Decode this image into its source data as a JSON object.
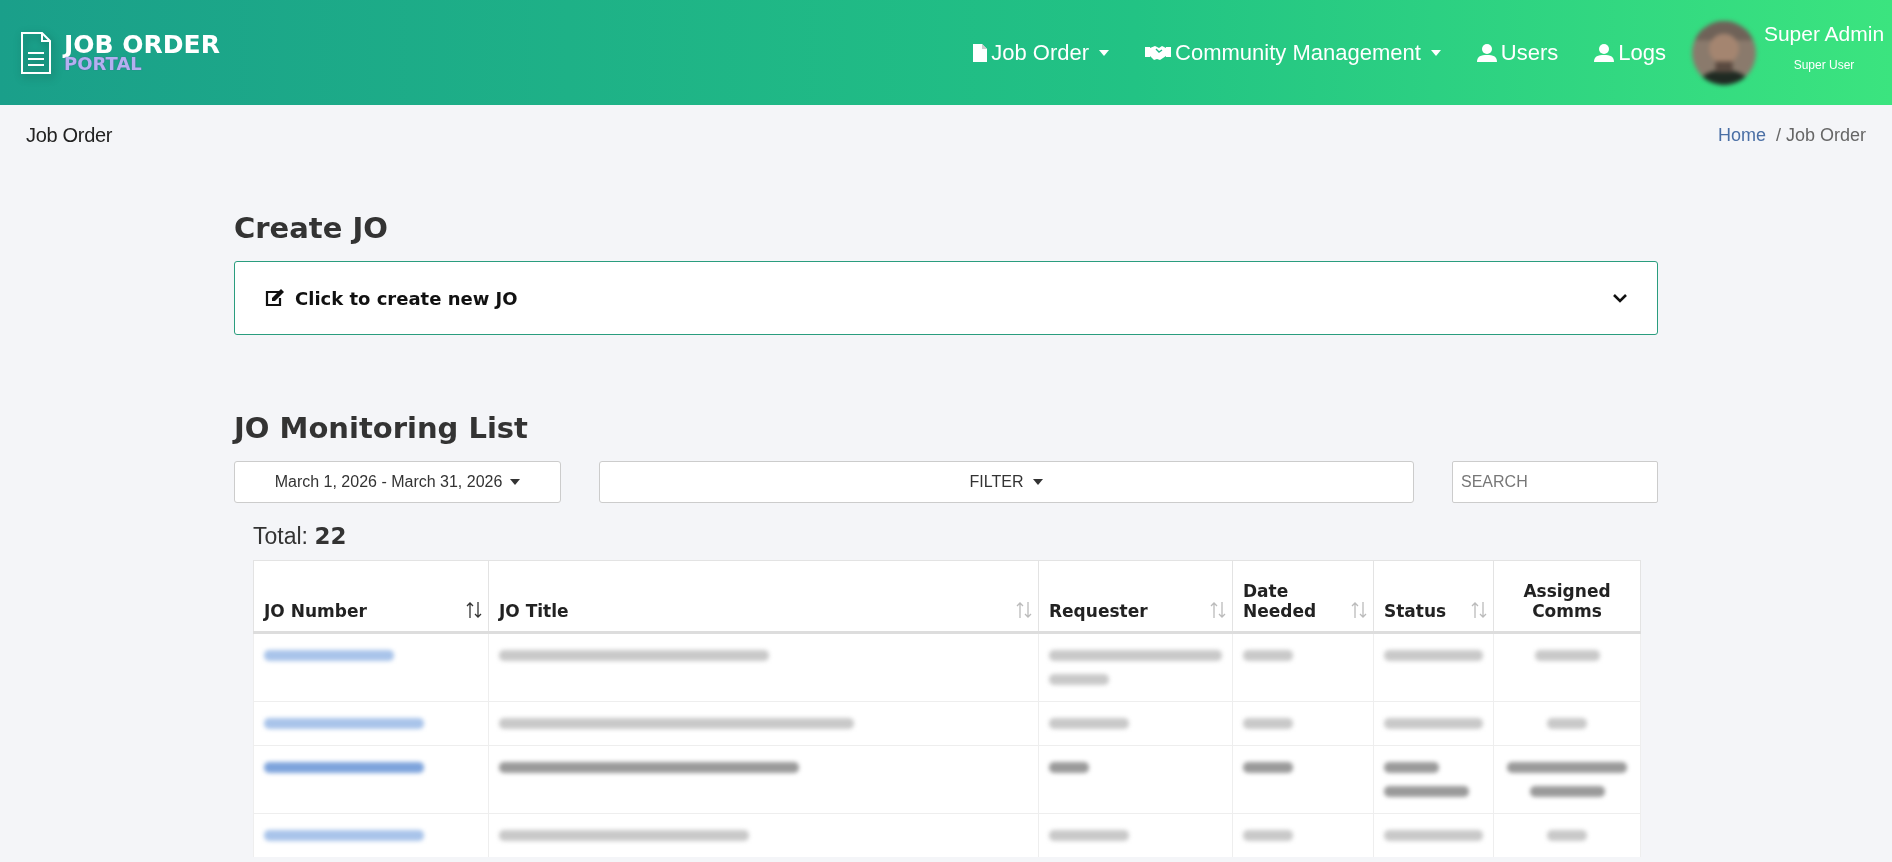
{
  "brand": {
    "title": "JOB ORDER",
    "subtitle": "PORTAL"
  },
  "nav": [
    {
      "label": "Job Order",
      "dropdown": true
    },
    {
      "label": "Community Management",
      "dropdown": true
    },
    {
      "label": "Users",
      "dropdown": false
    },
    {
      "label": "Logs",
      "dropdown": false
    }
  ],
  "user": {
    "name": "Super Admin",
    "role": "Super User"
  },
  "page_title": "Job Order",
  "breadcrumb": [
    {
      "label": "Home",
      "link": true
    },
    {
      "label": "/ Job Order",
      "link": false
    }
  ],
  "create": {
    "heading": "Create JO",
    "toggle": "Click to create new JO",
    "expanded": false
  },
  "monitoring": {
    "heading": "JO Monitoring List",
    "date_range": "March 1, 2026 - March 31, 2026",
    "filter": "FILTER",
    "search": {
      "placeholder": "SEARCH"
    },
    "total_label": "Total:",
    "total": "22"
  },
  "table": {
    "columns": [
      {
        "label": "JO Number",
        "sortable": true
      },
      {
        "label": "JO Title",
        "sortable": true
      },
      {
        "label": "Requester",
        "sortable": true
      },
      {
        "label": "Date Needed",
        "sortable": true
      },
      {
        "label": "Status",
        "sortable": true
      },
      {
        "label": "Assigned Comms",
        "sortable": false
      }
    ],
    "rows": [
      {
        "unread": false
      },
      {
        "unread": false
      },
      {
        "unread": true
      },
      {
        "unread": false
      }
    ]
  }
}
